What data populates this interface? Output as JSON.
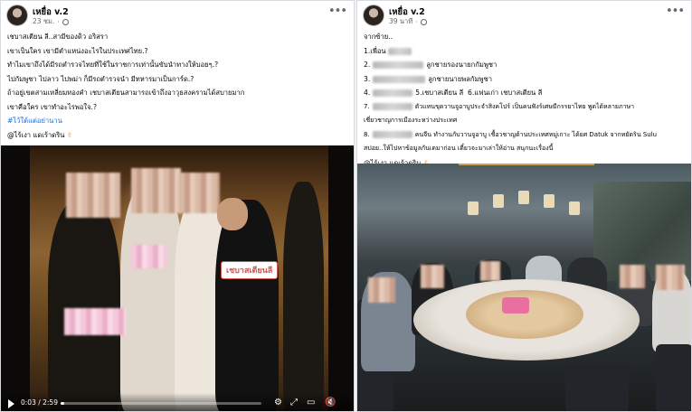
{
  "left_post": {
    "author": "เหยื่อ v.2",
    "time": "23 ชม.",
    "lines": [
      "เชบาสเตียน ลี..สามีของดิว อริสรา",
      "เขาเป็นใคร เขามีตำแหน่งอะไรในประเทศไทย.?",
      "ทำไมเขาถึงได้มีรถตำรวจไทยที่ใช้ในราชการเท่านั้นขับนำทางให้บอยๆ.?",
      "ไปกัมพูชา ไปลาว ไปพม่า ก็มีรถตำรวจนำ มีทหารมาเป็นการ์ด.?",
      "ถ้าอยู่เขตสามเหลี่ยมทองคำ เชบาสเตียนสามารถเข้าถึงอาวุธสงครามได้สบายมาก",
      "เขาคือใคร เขาทำอะไรพอใจ.?"
    ],
    "hashtag": "#ไว้ใต้แต่อย่านาน",
    "mention": "@ไร้เงา แดเร้าดริน",
    "video": {
      "callout": "เชบาสเตียนลี",
      "time": "0:03 / 2:59",
      "progress": 0.02
    }
  },
  "right_post": {
    "author": "เหยื่อ v.2",
    "time": "39 นาที",
    "lines": [
      "จากซ้าย..",
      "1.เพื่อน",
      "2.",
      "ลูกชายรองนายกกัมพูชา",
      "3.",
      "ลูกชายนายพลกัมพูชา",
      "4.",
      "5.เชบาสเตียน ลี",
      "6.แฟนเก่า เชบาสเตียน ลี",
      "7.",
      "ตัวแทนขุดวานจูอาบูประจำสิงคโปร์ เป็นคนฟังร์เศษมีกรรยาไทย พูดได้หลายภาษา",
      "เชี่ยวชาญการเมืองระหว่างประเทศ",
      "8.",
      "คนจีน ทำงานกับวานจูอาบู เชื้อวชาญด้านประเทศหมู่เกาะ ได้ยศ Datuk จากทยัดริน Sulu",
      "สปอย..ให้ไปหาข้อมูลกันเดมาก่อน เดี๋ยวจะมาเล่าให้อ่าน สนุกนะเรื่องนี้",
      "@ไร้เงา แดเร้าดริน"
    ]
  }
}
